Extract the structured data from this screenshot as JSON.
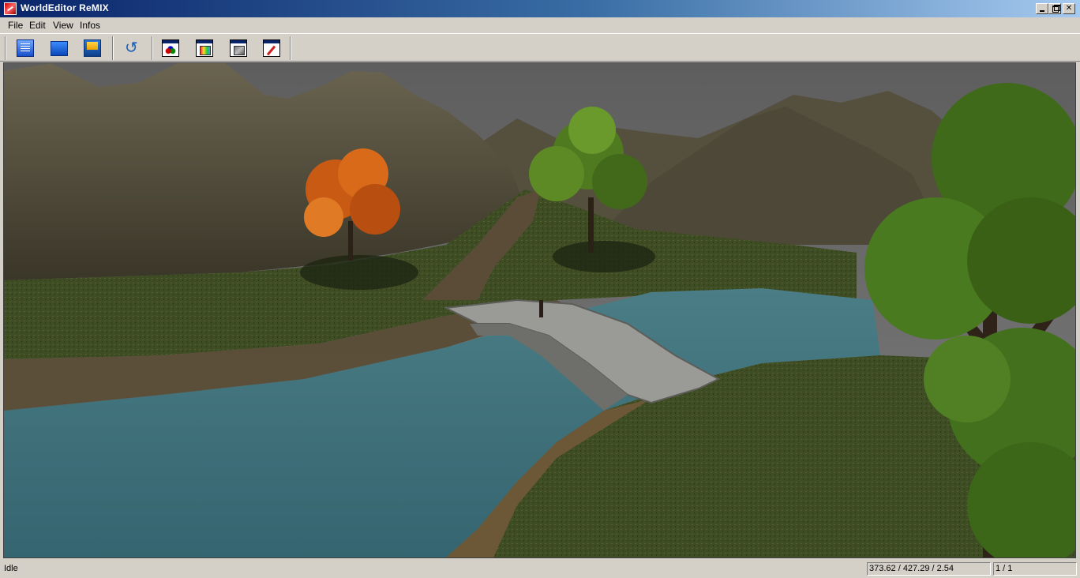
{
  "window": {
    "title": "WorldEditor ReMIX"
  },
  "menu": {
    "items": [
      "File",
      "Edit",
      "View",
      "Infos"
    ]
  },
  "toolbar": {
    "buttons": [
      {
        "icon": "new-document-icon"
      },
      {
        "icon": "open-folder-icon"
      },
      {
        "icon": "save-icon"
      },
      {
        "icon": "undo-icon"
      },
      {
        "icon": "window-objects-icon"
      },
      {
        "icon": "window-textures-icon"
      },
      {
        "icon": "window-terrain-icon"
      },
      {
        "icon": "window-brush-icon"
      }
    ]
  },
  "viewport": {
    "content": "3d-scene",
    "colors": {
      "sky": "#6e6e6e",
      "mountain": "#4f4a3c",
      "grass": "#3f4d24",
      "water": "#3d6f7a",
      "bridge": "#9a9a96",
      "autumn_tree": "#d96a1a",
      "green_tree": "#4f7a1f"
    }
  },
  "statusbar": {
    "status": "Idle",
    "coords": "373.62 / 427.29 / 2.54",
    "page": "1 / 1"
  }
}
